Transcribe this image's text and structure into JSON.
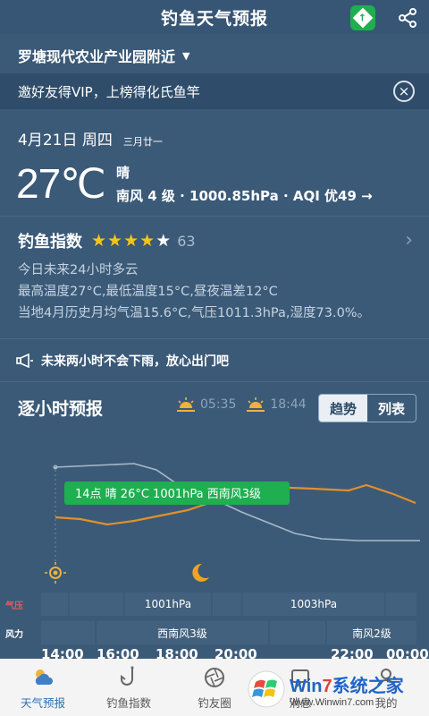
{
  "appbar": {
    "title": "钓鱼天气预报"
  },
  "location": {
    "name": "罗塘现代农业产业园附近"
  },
  "banner": {
    "text": "邀好友得VIP，上榜得化氏鱼竿"
  },
  "today": {
    "date": "4月21日 周四",
    "lunar": "三月廿一",
    "temperature": "27℃",
    "condition": "晴",
    "detail": "南风 4 级 · 1000.85hPa · AQI 优49 →"
  },
  "fishing": {
    "title": "钓鱼指数",
    "stars_filled": 4,
    "stars_total": 5,
    "score": "63",
    "lines": [
      "今日未来24小时多云",
      "最高温度27°C,最低温度15°C,昼夜温差12°C",
      "当地4月历史月均气温15.6°C,气压1011.3hPa,湿度73.0%。"
    ]
  },
  "notice": {
    "text": "未来两小时不会下雨，放心出门吧"
  },
  "hourly": {
    "title": "逐小时预报",
    "sunrise": "05:35",
    "sunset": "18:44",
    "toggle": {
      "trend": "趋势",
      "list": "列表"
    },
    "tooltip": "14点 晴 26°C 1001hPa 西南风3级",
    "pressure_label": "气压",
    "wind_label": "风力",
    "pressure_values": [
      "1001hPa",
      "1003hPa"
    ],
    "wind_values": [
      "西南风3级",
      "南风2级"
    ],
    "times": [
      "14:00",
      "16:00",
      "18:00",
      "20:00",
      "22:00",
      "00:00"
    ]
  },
  "bottom_nav": {
    "items": [
      {
        "label": "天气预报",
        "icon": "weather-icon",
        "active": true
      },
      {
        "label": "钓鱼指数",
        "icon": "fishhook-icon",
        "active": false
      },
      {
        "label": "钓友圈",
        "icon": "aperture-icon",
        "active": false
      },
      {
        "label": "消息",
        "icon": "message-icon",
        "active": false
      },
      {
        "label": "我的",
        "icon": "user-icon",
        "active": false
      }
    ]
  },
  "watermark": {
    "title_part1": "Win",
    "title_seven": "7",
    "title_part2": "系统之家",
    "url": "Www.Winwin7.com"
  },
  "colors": {
    "background": "#3b5a78",
    "accent_green": "#1fae50",
    "star_yellow": "#f5c518",
    "temp_line": "#e0902c",
    "pressure_line": "#a8b9c9",
    "nav_active": "#2f6fb3"
  }
}
